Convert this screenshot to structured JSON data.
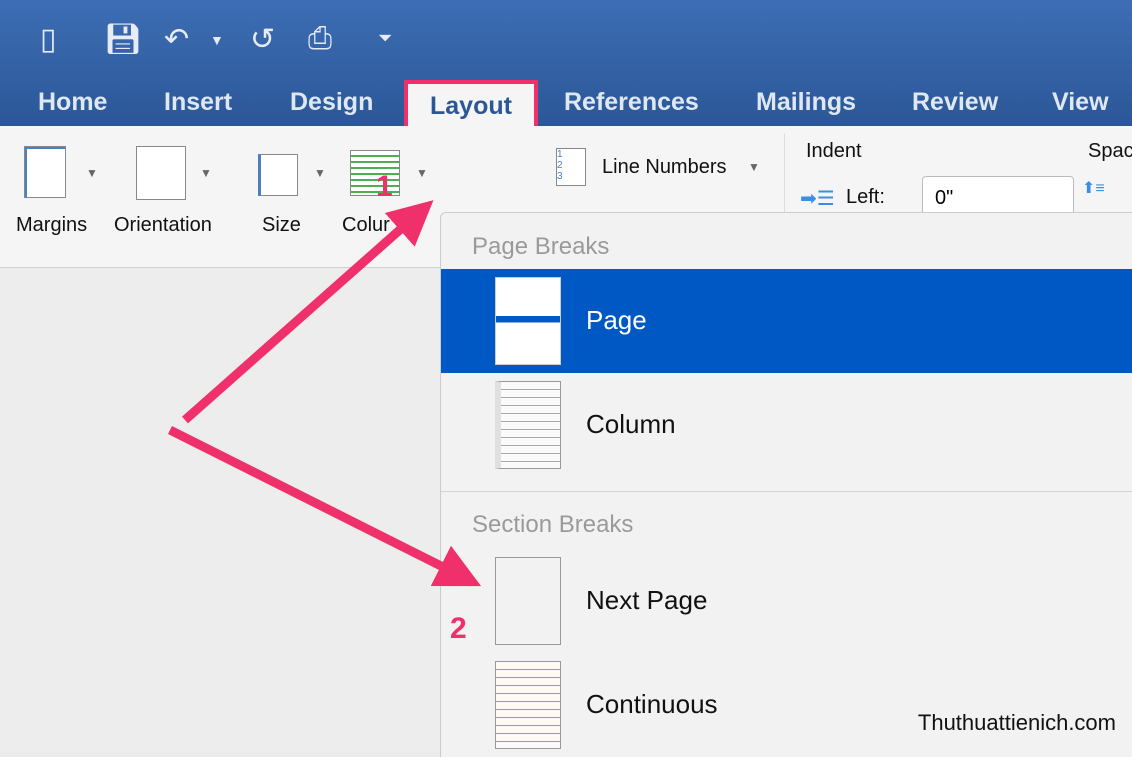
{
  "quick_access": {
    "icons": [
      "sidebar-icon",
      "save-icon",
      "undo-icon",
      "redo-icon",
      "print-icon",
      "customize-icon"
    ]
  },
  "tabs": [
    {
      "label": "Home"
    },
    {
      "label": "Insert"
    },
    {
      "label": "Design"
    },
    {
      "label": "Layout",
      "active": true
    },
    {
      "label": "References"
    },
    {
      "label": "Mailings"
    },
    {
      "label": "Review"
    },
    {
      "label": "View"
    }
  ],
  "ribbon": {
    "margins": "Margins",
    "orientation": "Orientation",
    "size": "Size",
    "columns": "Colur",
    "line_numbers": "Line Numbers",
    "indent": "Indent",
    "left_label": "Left:",
    "left_value": "0\"",
    "spacing": "Spac"
  },
  "menu": {
    "page_breaks": "Page Breaks",
    "section_breaks": "Section Breaks",
    "items": [
      {
        "label": "Page",
        "selected": true
      },
      {
        "label": "Column"
      },
      {
        "label": "Next Page"
      },
      {
        "label": "Continuous"
      }
    ]
  },
  "annotations": {
    "step1": "1",
    "step2": "2",
    "arrow_color": "#f0306a"
  },
  "watermark": "Thuthuattienich.com",
  "colors": {
    "titlebar": "#2b5797",
    "selection": "#0058c4"
  }
}
